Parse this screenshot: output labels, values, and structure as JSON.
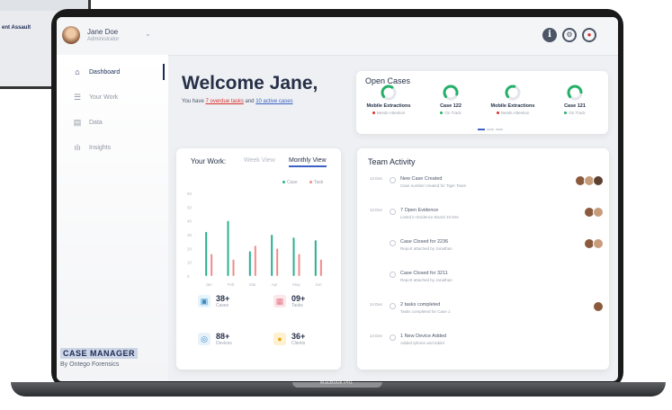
{
  "ghost_window": {
    "title": "ent Assault"
  },
  "user": {
    "name": "Jane Doe",
    "role": "Administrator"
  },
  "topbar_icons": [
    "info-icon",
    "settings-icon",
    "notifications-icon"
  ],
  "sidebar": {
    "items": [
      {
        "label": "Dashboard",
        "icon": "home-icon",
        "active": true
      },
      {
        "label": "Your Work",
        "icon": "work-icon",
        "active": false
      },
      {
        "label": "Data",
        "icon": "data-icon",
        "active": false
      },
      {
        "label": "Insights",
        "icon": "insights-icon",
        "active": false
      }
    ],
    "logo_title": "CASE MANAGER",
    "logo_sub": "By Ontego Forensics"
  },
  "welcome": {
    "title": "Welcome Jane,",
    "sub_prefix": "You have ",
    "overdue": "7 overdue tasks",
    "sub_mid": " and ",
    "active": "10 active cases"
  },
  "open_cases": {
    "title": "Open Cases",
    "items": [
      {
        "name": "Mobile Extractions",
        "stat": "Needs Attention",
        "progress": 0.45,
        "dot_color": "#d8332f"
      },
      {
        "name": "Case 122",
        "stat": "On Track",
        "progress": 0.65,
        "dot_color": "#25b06a"
      },
      {
        "name": "Mobile Extractions",
        "stat": "Needs Attention",
        "progress": 0.4,
        "dot_color": "#d8332f"
      },
      {
        "name": "Case 121",
        "stat": "On Track",
        "progress": 0.6,
        "dot_color": "#25b06a"
      }
    ]
  },
  "your_work": {
    "title": "Your Work:",
    "tab_week": "Week View",
    "tab_month": "Monthly View",
    "legend_case": "Case",
    "legend_task": "Task",
    "colors": {
      "case": "#2bb08f",
      "task": "#f08b8b"
    },
    "stats": [
      {
        "value": "38+",
        "label": "Cases",
        "icon": "briefcase-icon",
        "color": "#e6f4fb"
      },
      {
        "value": "09+",
        "label": "Tasks",
        "icon": "calendar-icon",
        "color": "#fbe6ea"
      },
      {
        "value": "88+",
        "label": "Devices",
        "icon": "device-icon",
        "color": "#e8f2fb"
      },
      {
        "value": "36+",
        "label": "Clients",
        "icon": "user-icon",
        "color": "#fdf1cf"
      }
    ]
  },
  "chart_data": {
    "type": "bar",
    "categories": [
      "Jan",
      "Feb",
      "Mar",
      "Apr",
      "May",
      "Jun"
    ],
    "series": [
      {
        "name": "Case",
        "values": [
          32,
          40,
          18,
          30,
          28,
          26
        ]
      },
      {
        "name": "Task",
        "values": [
          16,
          12,
          22,
          20,
          16,
          12
        ]
      }
    ],
    "y_ticks": [
      "60",
      "50",
      "40",
      "30",
      "20",
      "10",
      "0"
    ],
    "ylim": [
      0,
      60
    ]
  },
  "team_activity": {
    "title": "Team Activity",
    "items": [
      {
        "date": "13 Dec",
        "title": "New Case Created",
        "desc": "Case number created for Tiger Team",
        "avatars": 3
      },
      {
        "date": "13 Dec",
        "title": "7 Open Evidence",
        "desc": "Listed in Evidence Board 10 Dec",
        "avatars": 2
      },
      {
        "date": "",
        "title": "Case Closed for 2236",
        "desc": "Report attached by Jonathan",
        "avatars": 2
      },
      {
        "date": "",
        "title": "Case Closed for 3211",
        "desc": "Report attached by Jonathan",
        "avatars": 0
      },
      {
        "date": "14 Dec",
        "title": "2 tasks completed",
        "desc": "Tasks completed for Case 1",
        "avatars": 1
      },
      {
        "date": "14 Dec",
        "title": "1 New Device Added",
        "desc": "Added Iphone and tablet",
        "avatars": 0
      }
    ]
  },
  "laptop_label": "MacBook Pro"
}
